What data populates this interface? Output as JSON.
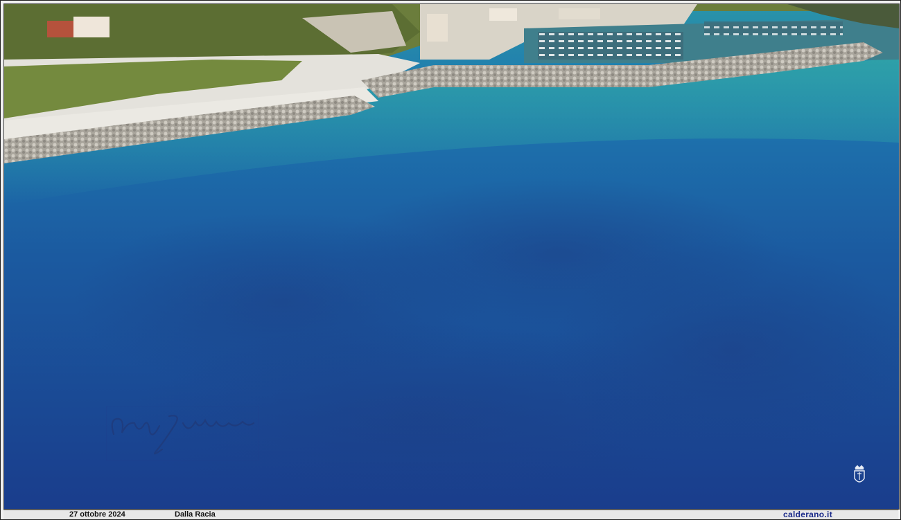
{
  "photo": {
    "subject": "aerial-sea-harbour",
    "colors": {
      "deep_sea": "#1f3f8f",
      "mid_sea": "#1e6aa8",
      "shallow_sea": "#2a94a8",
      "breakwater": "#b9b6ad",
      "vegetation": "#6b7d3c",
      "road": "#e4e2dc"
    }
  },
  "watermark": {
    "type": "handwritten-signature"
  },
  "crest": {
    "icon": "crest-icon"
  },
  "caption": {
    "date": "27 ottobre 2024",
    "place": "Dalla Racia",
    "site": "calderano.it"
  }
}
